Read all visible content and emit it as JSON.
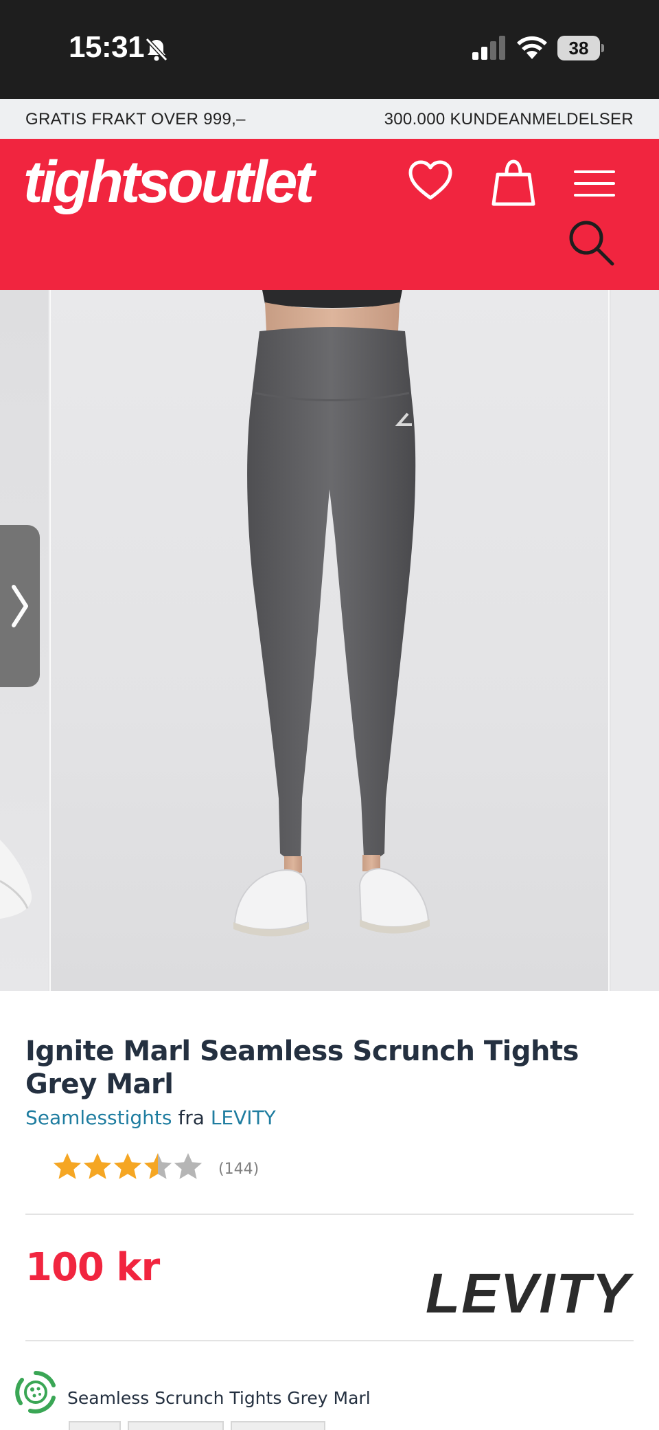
{
  "status_bar": {
    "time": "15:31",
    "battery": "38",
    "icons": [
      "bell-slash-icon",
      "cellular-signal-icon",
      "wifi-icon",
      "battery-icon"
    ]
  },
  "promo": {
    "left": "GRATIS FRAKT OVER 999,–",
    "right": "300.000 KUNDEANMELDELSER"
  },
  "header": {
    "logo": "tightsoutlet",
    "icons": [
      "heart-icon",
      "shopping-bag-icon",
      "hamburger-menu-icon",
      "search-icon"
    ],
    "background_color": "#f1253f"
  },
  "gallery": {
    "image": "Grey marl seamless leggings worn with white sneakers",
    "nav_icon": "chevron-right-icon"
  },
  "product": {
    "title": "Ignite Marl Seamless Scrunch Tights Grey Marl",
    "category": "Seamlesstights",
    "from_word": "fra",
    "brand": "LEVITY",
    "rating": 3.5,
    "rating_max": 5,
    "review_count": "(144)",
    "price": "100 kr",
    "brand_logo": "LEVITY",
    "variant_title": "Seamless Scrunch Tights Grey Marl"
  },
  "colors": {
    "accent": "#f1253f",
    "link": "#1f7da0",
    "star_filled": "#f5a623",
    "star_empty": "#b5b5b5"
  }
}
